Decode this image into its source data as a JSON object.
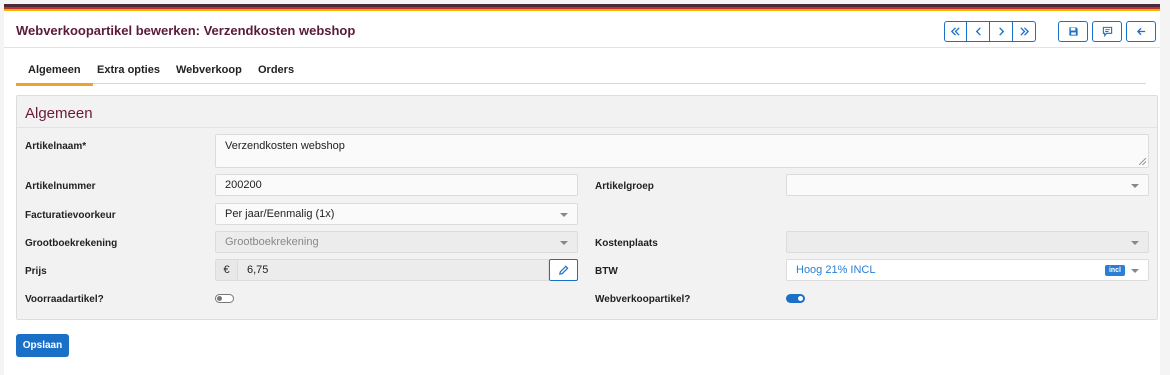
{
  "header": {
    "title": "Webverkoopartikel bewerken: Verzendkosten webshop",
    "nav_buttons": [
      "first-icon",
      "previous-icon",
      "next-icon",
      "last-icon"
    ],
    "action_buttons": [
      "save-icon",
      "comment-icon",
      "back-icon"
    ]
  },
  "tabs": [
    {
      "label": "Algemeen",
      "active": true
    },
    {
      "label": "Extra opties",
      "active": false
    },
    {
      "label": "Webverkoop",
      "active": false
    },
    {
      "label": "Orders",
      "active": false
    }
  ],
  "panel": {
    "title": "Algemeen",
    "artikelnaam": {
      "label": "Artikelnaam*",
      "value": "Verzendkosten webshop"
    },
    "artikelnummer": {
      "label": "Artikelnummer",
      "value": "200200"
    },
    "artikelgroep": {
      "label": "Artikelgroep",
      "value": ""
    },
    "facturatievoorkeur": {
      "label": "Facturatievoorkeur",
      "value": "Per jaar/Eenmalig (1x)"
    },
    "grootboekrekening": {
      "label": "Grootboekrekening",
      "placeholder": "Grootboekrekening"
    },
    "kostenplaats": {
      "label": "Kostenplaats",
      "value": ""
    },
    "prijs": {
      "label": "Prijs",
      "currency": "€",
      "value": "6,75"
    },
    "btw": {
      "label": "BTW",
      "value": "Hoog 21% INCL",
      "badge": "incl"
    },
    "voorraadartikel": {
      "label": "Voorraadartikel?",
      "checked": false
    },
    "webverkoopartikel": {
      "label": "Webverkoopartikel?",
      "checked": true
    }
  },
  "footer": {
    "save_label": "Opslaan"
  },
  "colors": {
    "accent": "#1a6fc7",
    "title": "#5a1a3a",
    "tab_underline": "#f0a030"
  }
}
